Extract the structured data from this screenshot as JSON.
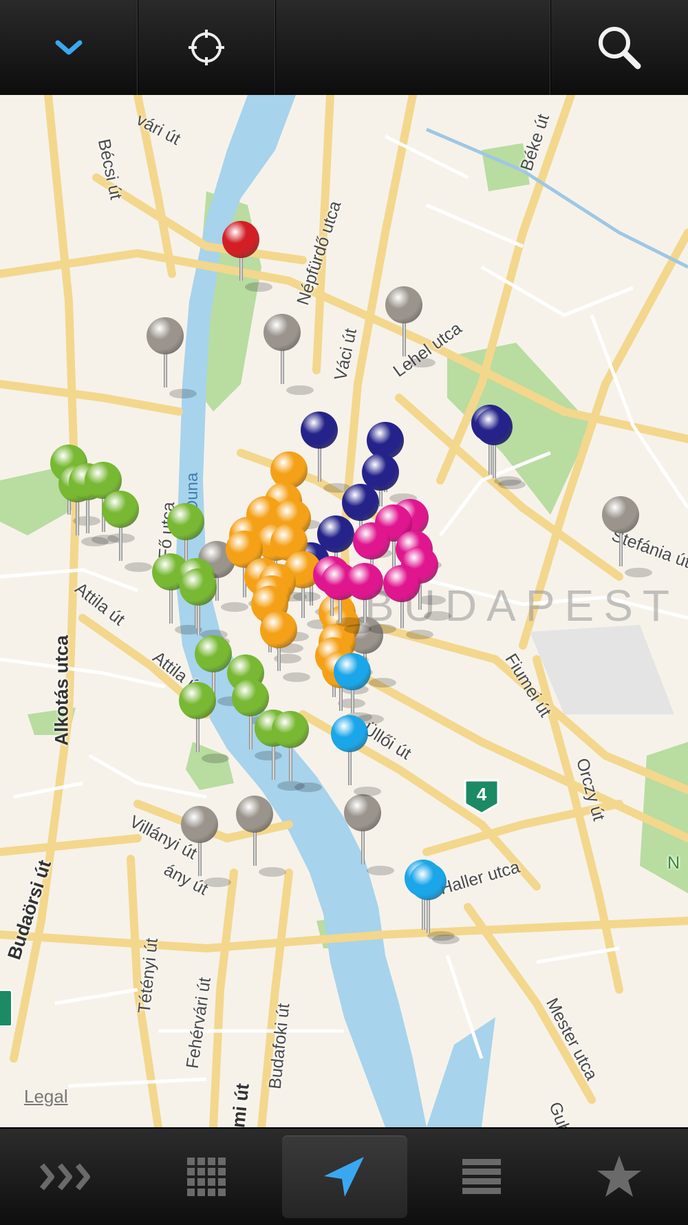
{
  "toolbar": {
    "collapse_icon": "chevron-down-icon",
    "locate_icon": "crosshair-icon",
    "search_icon": "search-icon"
  },
  "map": {
    "city_label": "BUDAPEST",
    "river_label": "Duna",
    "legal_label": "Legal",
    "route_shield": "4",
    "streets": [
      {
        "name": "Bécsi út"
      },
      {
        "name": "vári út"
      },
      {
        "name": "Népfürdő utca"
      },
      {
        "name": "Váci út"
      },
      {
        "name": "Lehel utca"
      },
      {
        "name": "Béke út"
      },
      {
        "name": "Fő utca"
      },
      {
        "name": "Attila út"
      },
      {
        "name": "Attila út"
      },
      {
        "name": "Alkotás utca"
      },
      {
        "name": "Fiumei út"
      },
      {
        "name": "Üllői út"
      },
      {
        "name": "Orczy út"
      },
      {
        "name": "Villányi út"
      },
      {
        "name": "Haller utca"
      },
      {
        "name": "Budaörsi út"
      },
      {
        "name": "Tétényi út"
      },
      {
        "name": "Fehérvári út"
      },
      {
        "name": "Budafoki út"
      },
      {
        "name": "Mester utca"
      },
      {
        "name": "Stefánia út"
      },
      {
        "name": "émi út"
      },
      {
        "name": "Guba"
      },
      {
        "name": "N"
      },
      {
        "name": "ány út"
      }
    ],
    "pin_colors": {
      "red": "#d21f26",
      "gray": "#9a948c",
      "navy": "#25238a",
      "green": "#78b833",
      "orange": "#f5a117",
      "magenta": "#e0168f",
      "cyan": "#1aa6e8"
    }
  },
  "tabs": [
    {
      "name": "more-icon"
    },
    {
      "name": "grid-icon"
    },
    {
      "name": "navigation-arrow-icon",
      "active": true
    },
    {
      "name": "list-icon"
    },
    {
      "name": "star-icon"
    }
  ]
}
